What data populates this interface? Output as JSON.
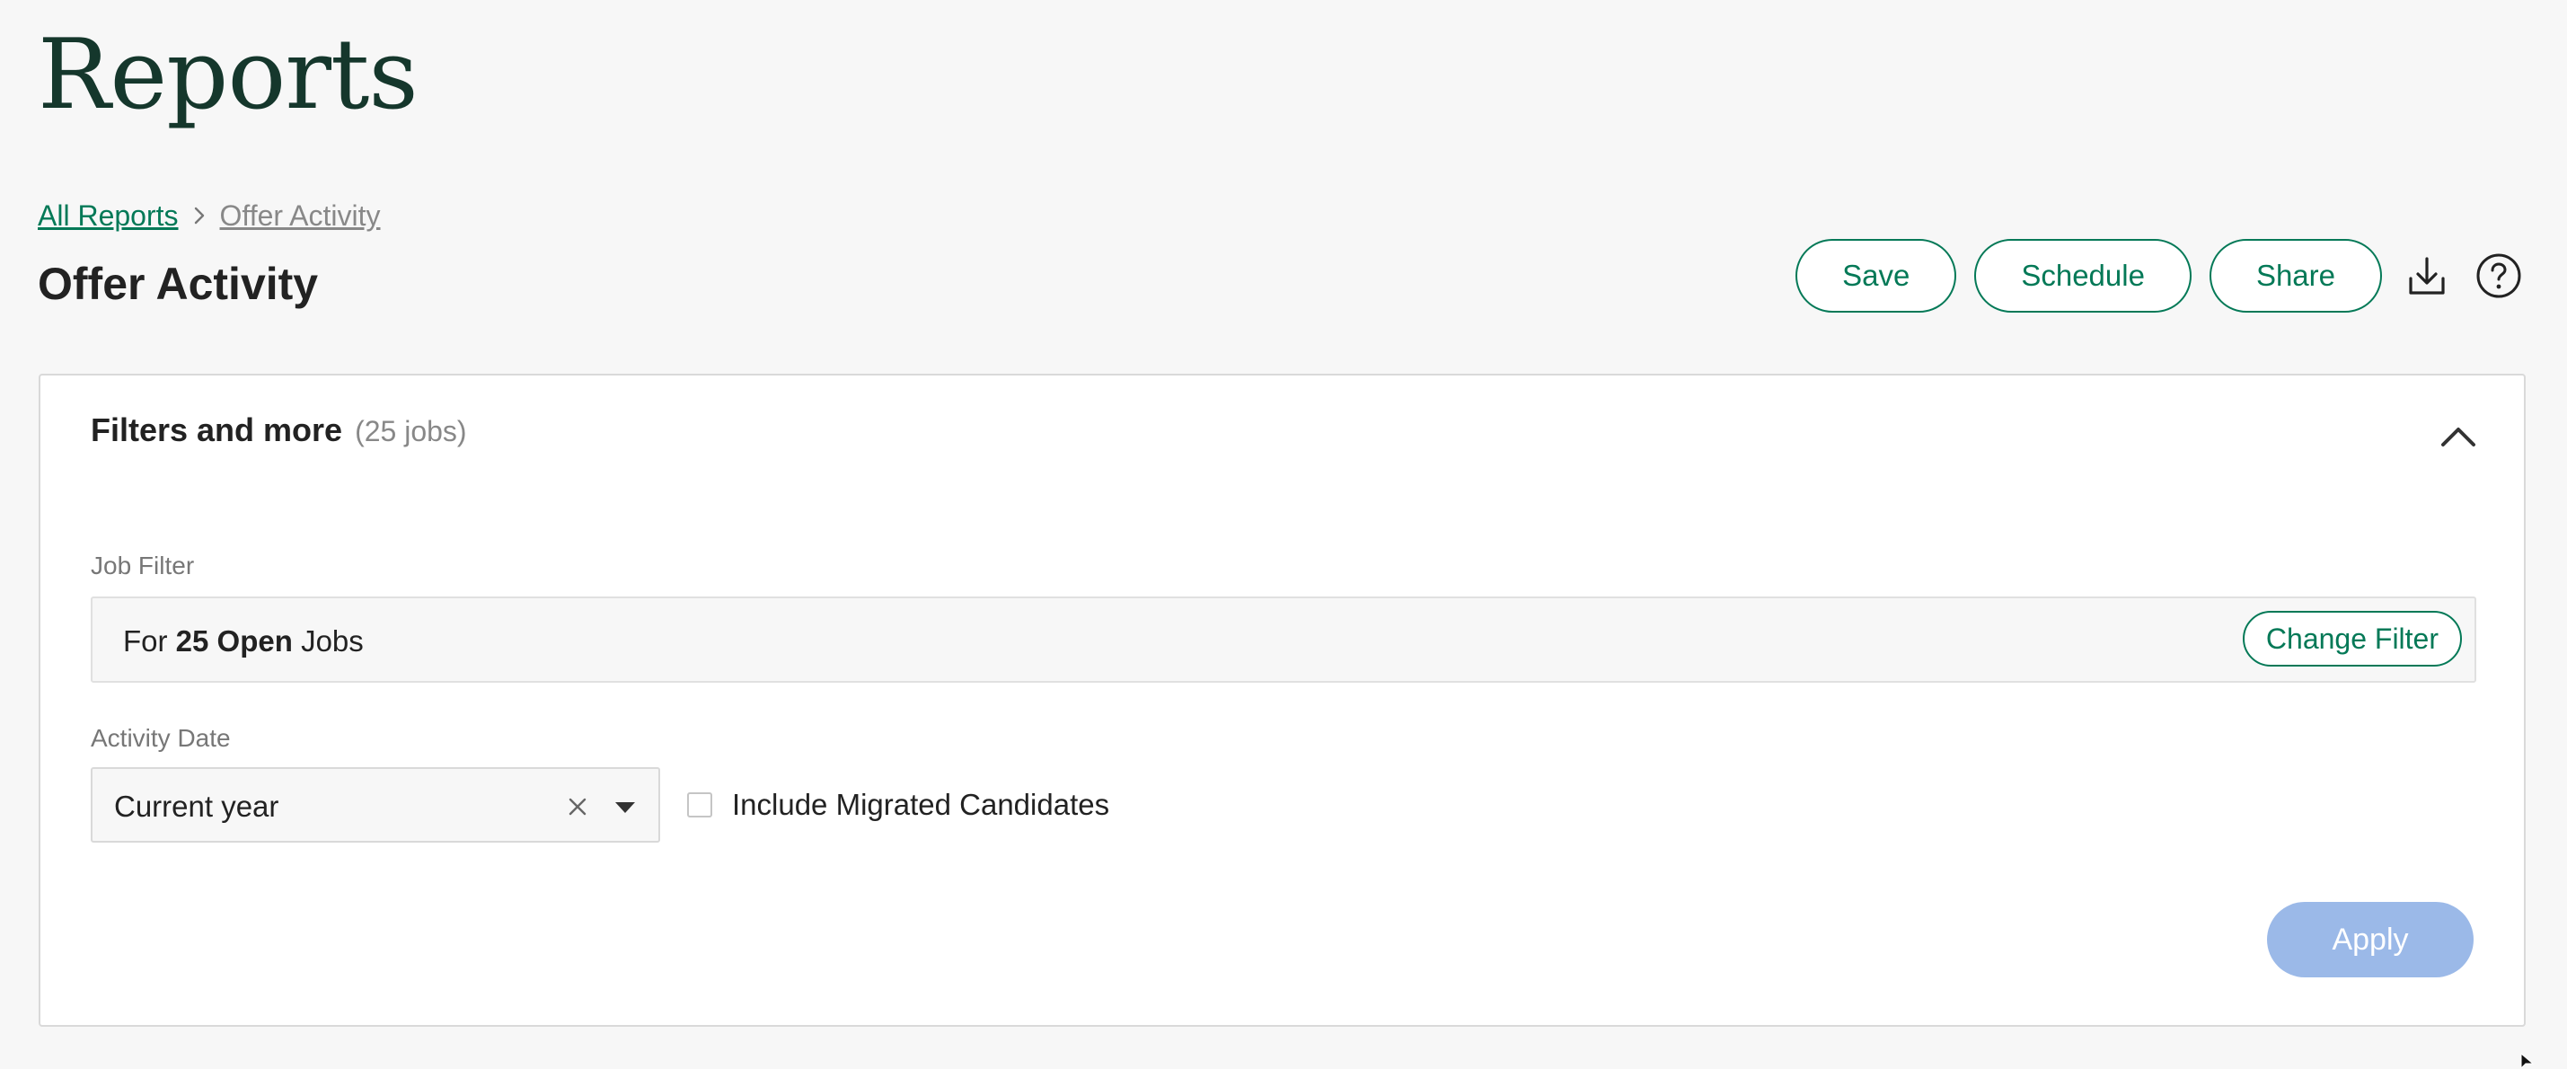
{
  "page": {
    "title": "Reports"
  },
  "breadcrumb": {
    "root": "All Reports",
    "current": "Offer Activity",
    "separator_icon": "chevron-right-icon"
  },
  "report": {
    "title": "Offer Activity"
  },
  "actions": {
    "save_label": "Save",
    "schedule_label": "Schedule",
    "share_label": "Share",
    "download_icon": "download-icon",
    "help_icon": "help-icon"
  },
  "filters": {
    "title": "Filters and more",
    "count": "(25 jobs)",
    "collapse_icon": "chevron-up-icon",
    "job_filter": {
      "label": "Job Filter",
      "prefix": "For",
      "highlight": "25 Open",
      "suffix": "Jobs",
      "change_label": "Change Filter"
    },
    "activity_date": {
      "label": "Activity Date",
      "value": "Current year"
    },
    "migrated": {
      "label": "Include Migrated Candidates",
      "checked": false
    },
    "apply_label": "Apply"
  },
  "colors": {
    "accent": "#047957",
    "title": "#15372c",
    "apply_disabled": "#9bb9e8",
    "background": "#f7f7f7"
  }
}
